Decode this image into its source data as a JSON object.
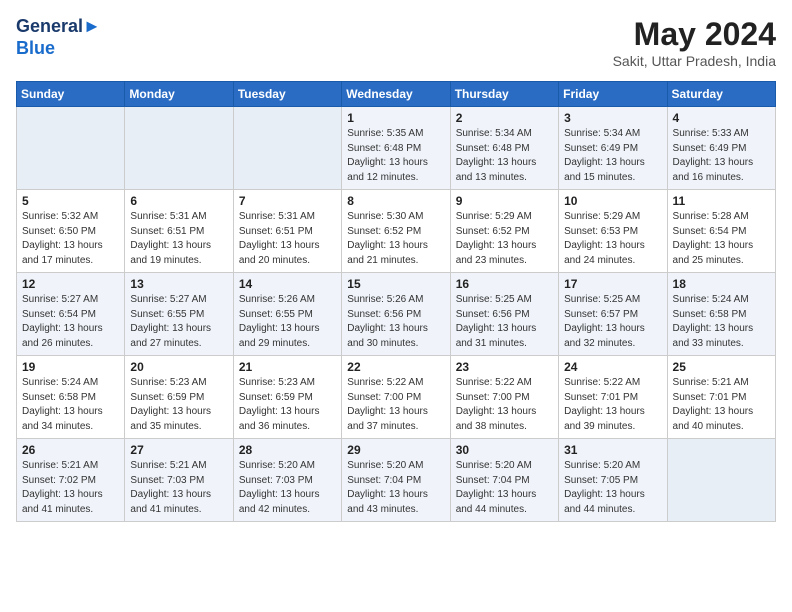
{
  "header": {
    "logo_line1": "General",
    "logo_line2": "Blue",
    "month_year": "May 2024",
    "location": "Sakit, Uttar Pradesh, India"
  },
  "weekdays": [
    "Sunday",
    "Monday",
    "Tuesday",
    "Wednesday",
    "Thursday",
    "Friday",
    "Saturday"
  ],
  "weeks": [
    [
      {
        "day": "",
        "empty": true
      },
      {
        "day": "",
        "empty": true
      },
      {
        "day": "",
        "empty": true
      },
      {
        "day": "1",
        "sunrise": "5:35 AM",
        "sunset": "6:48 PM",
        "daylight": "13 hours and 12 minutes."
      },
      {
        "day": "2",
        "sunrise": "5:34 AM",
        "sunset": "6:48 PM",
        "daylight": "13 hours and 13 minutes."
      },
      {
        "day": "3",
        "sunrise": "5:34 AM",
        "sunset": "6:49 PM",
        "daylight": "13 hours and 15 minutes."
      },
      {
        "day": "4",
        "sunrise": "5:33 AM",
        "sunset": "6:49 PM",
        "daylight": "13 hours and 16 minutes."
      }
    ],
    [
      {
        "day": "5",
        "sunrise": "5:32 AM",
        "sunset": "6:50 PM",
        "daylight": "13 hours and 17 minutes."
      },
      {
        "day": "6",
        "sunrise": "5:31 AM",
        "sunset": "6:51 PM",
        "daylight": "13 hours and 19 minutes."
      },
      {
        "day": "7",
        "sunrise": "5:31 AM",
        "sunset": "6:51 PM",
        "daylight": "13 hours and 20 minutes."
      },
      {
        "day": "8",
        "sunrise": "5:30 AM",
        "sunset": "6:52 PM",
        "daylight": "13 hours and 21 minutes."
      },
      {
        "day": "9",
        "sunrise": "5:29 AM",
        "sunset": "6:52 PM",
        "daylight": "13 hours and 23 minutes."
      },
      {
        "day": "10",
        "sunrise": "5:29 AM",
        "sunset": "6:53 PM",
        "daylight": "13 hours and 24 minutes."
      },
      {
        "day": "11",
        "sunrise": "5:28 AM",
        "sunset": "6:54 PM",
        "daylight": "13 hours and 25 minutes."
      }
    ],
    [
      {
        "day": "12",
        "sunrise": "5:27 AM",
        "sunset": "6:54 PM",
        "daylight": "13 hours and 26 minutes."
      },
      {
        "day": "13",
        "sunrise": "5:27 AM",
        "sunset": "6:55 PM",
        "daylight": "13 hours and 27 minutes."
      },
      {
        "day": "14",
        "sunrise": "5:26 AM",
        "sunset": "6:55 PM",
        "daylight": "13 hours and 29 minutes."
      },
      {
        "day": "15",
        "sunrise": "5:26 AM",
        "sunset": "6:56 PM",
        "daylight": "13 hours and 30 minutes."
      },
      {
        "day": "16",
        "sunrise": "5:25 AM",
        "sunset": "6:56 PM",
        "daylight": "13 hours and 31 minutes."
      },
      {
        "day": "17",
        "sunrise": "5:25 AM",
        "sunset": "6:57 PM",
        "daylight": "13 hours and 32 minutes."
      },
      {
        "day": "18",
        "sunrise": "5:24 AM",
        "sunset": "6:58 PM",
        "daylight": "13 hours and 33 minutes."
      }
    ],
    [
      {
        "day": "19",
        "sunrise": "5:24 AM",
        "sunset": "6:58 PM",
        "daylight": "13 hours and 34 minutes."
      },
      {
        "day": "20",
        "sunrise": "5:23 AM",
        "sunset": "6:59 PM",
        "daylight": "13 hours and 35 minutes."
      },
      {
        "day": "21",
        "sunrise": "5:23 AM",
        "sunset": "6:59 PM",
        "daylight": "13 hours and 36 minutes."
      },
      {
        "day": "22",
        "sunrise": "5:22 AM",
        "sunset": "7:00 PM",
        "daylight": "13 hours and 37 minutes."
      },
      {
        "day": "23",
        "sunrise": "5:22 AM",
        "sunset": "7:00 PM",
        "daylight": "13 hours and 38 minutes."
      },
      {
        "day": "24",
        "sunrise": "5:22 AM",
        "sunset": "7:01 PM",
        "daylight": "13 hours and 39 minutes."
      },
      {
        "day": "25",
        "sunrise": "5:21 AM",
        "sunset": "7:01 PM",
        "daylight": "13 hours and 40 minutes."
      }
    ],
    [
      {
        "day": "26",
        "sunrise": "5:21 AM",
        "sunset": "7:02 PM",
        "daylight": "13 hours and 41 minutes."
      },
      {
        "day": "27",
        "sunrise": "5:21 AM",
        "sunset": "7:03 PM",
        "daylight": "13 hours and 41 minutes."
      },
      {
        "day": "28",
        "sunrise": "5:20 AM",
        "sunset": "7:03 PM",
        "daylight": "13 hours and 42 minutes."
      },
      {
        "day": "29",
        "sunrise": "5:20 AM",
        "sunset": "7:04 PM",
        "daylight": "13 hours and 43 minutes."
      },
      {
        "day": "30",
        "sunrise": "5:20 AM",
        "sunset": "7:04 PM",
        "daylight": "13 hours and 44 minutes."
      },
      {
        "day": "31",
        "sunrise": "5:20 AM",
        "sunset": "7:05 PM",
        "daylight": "13 hours and 44 minutes."
      },
      {
        "day": "",
        "empty": true
      }
    ]
  ]
}
